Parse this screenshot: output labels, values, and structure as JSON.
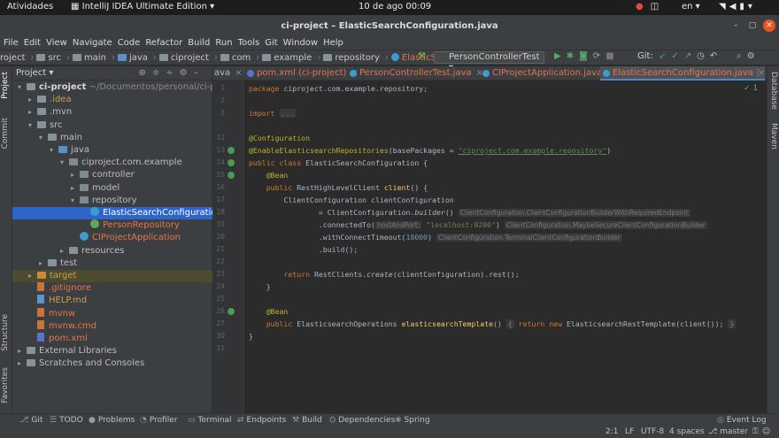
{
  "os": {
    "activities": "Atividades",
    "app_name": "IntelliJ IDEA Ultimate Edition",
    "clock": "10 de ago  00:09",
    "lang": "en"
  },
  "window": {
    "title": "ci-project – ElasticSearchConfiguration.java"
  },
  "menu": [
    "File",
    "Edit",
    "View",
    "Navigate",
    "Code",
    "Refactor",
    "Build",
    "Run",
    "Tools",
    "Git",
    "Window",
    "Help"
  ],
  "breadcrumb": [
    "roject",
    "src",
    "main",
    "java",
    "ciproject",
    "com",
    "example",
    "repository",
    "ElasticSearchConfiguration"
  ],
  "run_config": "PersonControllerTest",
  "git_label": "Git:",
  "side_tabs": {
    "project": "Project",
    "commit": "Commit",
    "structure": "Structure",
    "favorites": "Favorites",
    "database": "Database",
    "maven": "Maven"
  },
  "project_panel": {
    "title": "Project",
    "tree": [
      {
        "label": "ci-project",
        "extra": "~/Documentos/personal/ci-project",
        "depth": 0,
        "arrow": "▾",
        "icon": "folder",
        "color": "#d6d6d6",
        "bold": true
      },
      {
        "label": ".idea",
        "depth": 1,
        "arrow": "▸",
        "icon": "folder",
        "color": "#c7a04a"
      },
      {
        "label": ".mvn",
        "depth": 1,
        "arrow": "▸",
        "icon": "folder",
        "color": "#bdbdbd"
      },
      {
        "label": "src",
        "depth": 1,
        "arrow": "▾",
        "icon": "folder",
        "color": "#bdbdbd"
      },
      {
        "label": "main",
        "depth": 2,
        "arrow": "▾",
        "icon": "folder",
        "color": "#bdbdbd"
      },
      {
        "label": "java",
        "depth": 3,
        "arrow": "▾",
        "icon": "folder-blue",
        "color": "#bdbdbd"
      },
      {
        "label": "ciproject.com.example",
        "depth": 4,
        "arrow": "▾",
        "icon": "package",
        "color": "#bdbdbd"
      },
      {
        "label": "controller",
        "depth": 5,
        "arrow": "▸",
        "icon": "package",
        "color": "#bdbdbd"
      },
      {
        "label": "model",
        "depth": 5,
        "arrow": "▸",
        "icon": "package",
        "color": "#bdbdbd"
      },
      {
        "label": "repository",
        "depth": 5,
        "arrow": "▾",
        "icon": "package",
        "color": "#bdbdbd"
      },
      {
        "label": "ElasticSearchConfiguration",
        "depth": 6,
        "arrow": "",
        "icon": "class",
        "color": "#ffffff",
        "selected": true
      },
      {
        "label": "PersonRepository",
        "depth": 6,
        "arrow": "",
        "icon": "interface",
        "color": "#e8734a"
      },
      {
        "label": "CIProjectApplication",
        "depth": 5,
        "arrow": "",
        "icon": "class",
        "color": "#e8734a"
      },
      {
        "label": "resources",
        "depth": 4,
        "arrow": "▸",
        "icon": "folder",
        "color": "#bdbdbd"
      },
      {
        "label": "test",
        "depth": 2,
        "arrow": "▸",
        "icon": "folder",
        "color": "#bdbdbd"
      },
      {
        "label": "target",
        "depth": 1,
        "arrow": "▸",
        "icon": "folder-orange",
        "color": "#c7a04a",
        "highlight": true
      },
      {
        "label": ".gitignore",
        "depth": 1,
        "arrow": "",
        "icon": "file",
        "color": "#e8734a"
      },
      {
        "label": "HELP.md",
        "depth": 1,
        "arrow": "",
        "icon": "file-md",
        "color": "#c7a04a"
      },
      {
        "label": "mvnw",
        "depth": 1,
        "arrow": "",
        "icon": "file",
        "color": "#e8734a"
      },
      {
        "label": "mvnw.cmd",
        "depth": 1,
        "arrow": "",
        "icon": "file",
        "color": "#e8734a"
      },
      {
        "label": "pom.xml",
        "depth": 1,
        "arrow": "",
        "icon": "file-m",
        "color": "#e8734a"
      },
      {
        "label": "External Libraries",
        "depth": 0,
        "arrow": "▸",
        "icon": "libs",
        "color": "#bdbdbd"
      },
      {
        "label": "Scratches and Consoles",
        "depth": 0,
        "arrow": "▸",
        "icon": "scratch",
        "color": "#bdbdbd"
      }
    ]
  },
  "editor_tabs": [
    {
      "label": "ava",
      "dot": ""
    },
    {
      "label": "pom.xml (ci-project)",
      "dot": "#5a72c9",
      "color": "#e8734a"
    },
    {
      "label": "PersonControllerTest.java",
      "dot": "#3d9bd1",
      "color": "#e8734a"
    },
    {
      "label": "CIProjectApplication.java",
      "dot": "#3d9bd1",
      "color": "#e8734a"
    },
    {
      "label": "ElasticSearchConfiguration.java",
      "dot": "#3d9bd1",
      "color": "#e8734a",
      "active": true
    }
  ],
  "inspection_count": "✓ 1",
  "code": {
    "line_numbers": [
      "1",
      "2",
      "3",
      "",
      "12",
      "13",
      "14",
      "15",
      "16",
      "17",
      "18",
      "19",
      "20",
      "21",
      "22",
      "23",
      "24",
      "25",
      "26",
      "27",
      "30",
      "31"
    ],
    "hints": {
      "builder_type": "ClientConfiguration.ClientConfigurationBuilderWithRequiredEndpoint",
      "host_param": "hostAndPort:",
      "maybe_secure": "ClientConfiguration.MaybeSecureClientConfigurationBuilder",
      "terminal": "ClientConfiguration.TerminalClientConfigurationBuilder"
    },
    "package_kw": "package",
    "package_name": " ciproject.com.example.repository;",
    "import_kw": "import",
    "import_fold": "...",
    "configuration": "@Configuration",
    "enable_repos": "@EnableElasticsearchRepositories",
    "enable_args": "(basePackages = ",
    "enable_str": "\"ciproject.com.example.repository\"",
    "enable_close": ")",
    "public_class": "public class ",
    "class_name": "ElasticSearchConfiguration {",
    "bean": "@Bean",
    "public_kw": "public ",
    "rest_type": "RestHighLevelClient ",
    "client_fn": "client",
    "client_rest": "() {",
    "client_config_decl": "ClientConfiguration clientConfiguration",
    "eq_builder": "= ClientConfiguration.",
    "builder_fn": "builder",
    "builder_rest": "()",
    "connected_to": ".connectedTo(",
    "host_str": "\"localhost:9200\"",
    "connected_close": ")",
    "timeout": ".withConnectTimeout(",
    "timeout_num": "10000",
    "timeout_close": ")",
    "build": ".build();",
    "return_kw": "return ",
    "return_rest": "RestClients.",
    "create_fn": "create",
    "create_rest": "(clientConfiguration).rest();",
    "close_brace": "}",
    "ops_type": "ElasticsearchOperations ",
    "template_fn": "elasticsearchTemplate",
    "template_mid": "() ",
    "template_body_kw": "return new ",
    "template_body": "ElasticsearchRestTemplate(client());",
    "brace_open": "{",
    "brace_close": "}"
  },
  "bottom_tabs": [
    {
      "label": "Git",
      "icon": "⎇"
    },
    {
      "label": "TODO",
      "icon": "☰"
    },
    {
      "label": "Problems",
      "icon": "●"
    },
    {
      "label": "Profiler",
      "icon": "◔"
    },
    {
      "label": "Terminal",
      "icon": "▭"
    },
    {
      "label": "Endpoints",
      "icon": "⇄"
    },
    {
      "label": "Build",
      "icon": "⚒"
    },
    {
      "label": "Dependencies",
      "icon": "⛭"
    },
    {
      "label": "Spring",
      "icon": "❀"
    }
  ],
  "event_log": "Event Log",
  "status": {
    "position": "2:1",
    "line_sep": "LF",
    "encoding": "UTF-8",
    "indent": "4 spaces",
    "branch": "master"
  }
}
